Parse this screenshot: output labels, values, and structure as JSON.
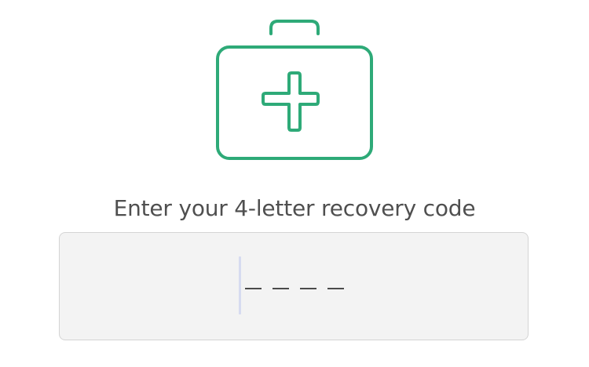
{
  "icon": {
    "name": "first-aid-kit-icon",
    "color": "#2eaa78"
  },
  "recovery": {
    "prompt": "Enter your 4-letter recovery code",
    "code_value": "",
    "code_length": 4,
    "field_background": "#f3f3f3"
  }
}
